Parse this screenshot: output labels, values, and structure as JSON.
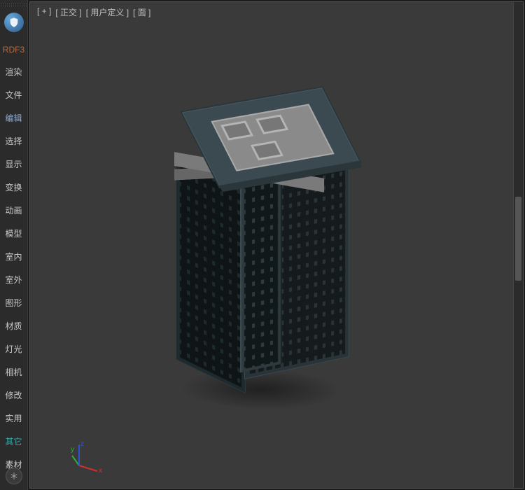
{
  "sidebar": {
    "logo_icon": "shield-icon",
    "items": [
      {
        "label": "RDF3",
        "cls": "special"
      },
      {
        "label": "渲染",
        "cls": ""
      },
      {
        "label": "文件",
        "cls": ""
      },
      {
        "label": "编辑",
        "cls": "active"
      },
      {
        "label": "选择",
        "cls": ""
      },
      {
        "label": "显示",
        "cls": ""
      },
      {
        "label": "变换",
        "cls": ""
      },
      {
        "label": "动画",
        "cls": ""
      },
      {
        "label": "模型",
        "cls": ""
      },
      {
        "label": "室内",
        "cls": ""
      },
      {
        "label": "室外",
        "cls": ""
      },
      {
        "label": "图形",
        "cls": ""
      },
      {
        "label": "材质",
        "cls": ""
      },
      {
        "label": "灯光",
        "cls": ""
      },
      {
        "label": "相机",
        "cls": ""
      },
      {
        "label": "修改",
        "cls": ""
      },
      {
        "label": "实用",
        "cls": ""
      },
      {
        "label": "其它",
        "cls": "teal"
      },
      {
        "label": "素材",
        "cls": ""
      }
    ],
    "bottom_icon": "asterisk-icon"
  },
  "viewport": {
    "labels": [
      "[ + ]",
      "[ 正交 ]",
      "[ 用户定义 ]",
      "[ 面 ]"
    ],
    "gizmo": {
      "x": "x",
      "y": "y",
      "z": "z"
    }
  }
}
